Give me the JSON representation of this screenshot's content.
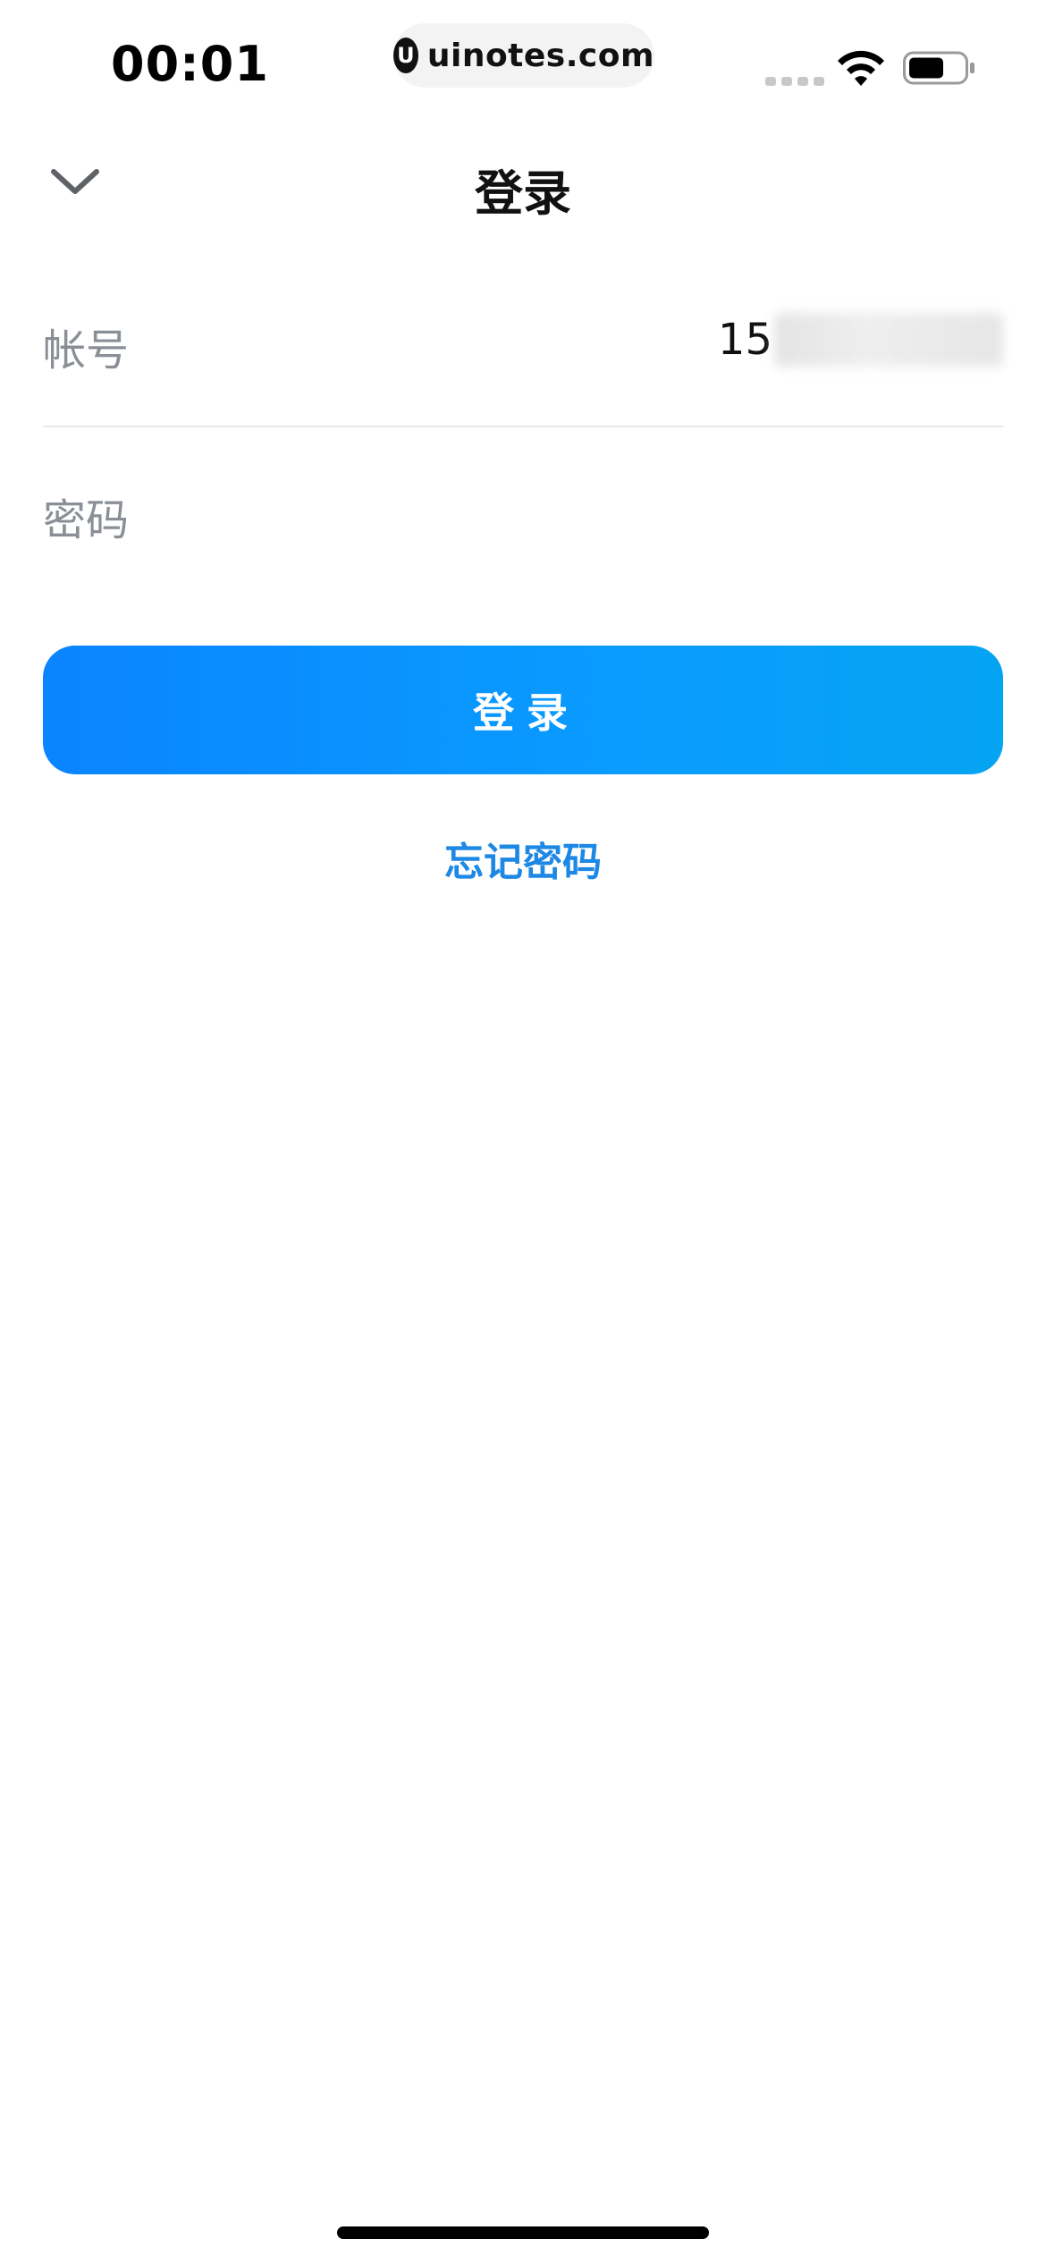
{
  "status_bar": {
    "time": "00:01",
    "url": "uinotes.com",
    "site_icon_glyph": "U",
    "icons": [
      "signal-icon",
      "wifi-icon",
      "battery-icon"
    ]
  },
  "nav": {
    "title": "登录",
    "back_icon": "chevron-down-icon"
  },
  "form": {
    "account_label": "帐号",
    "account_value_visible": "15",
    "password_label": "密码",
    "password_value": "",
    "password_placeholder": ""
  },
  "actions": {
    "login_label": "登录",
    "forgot_label": "忘记密码"
  },
  "colors": {
    "primary": "#0A84FF",
    "primary_end": "#05A4F2",
    "link": "#1E88E5",
    "label": "#8A8F96",
    "divider": "#E9E9EC"
  }
}
